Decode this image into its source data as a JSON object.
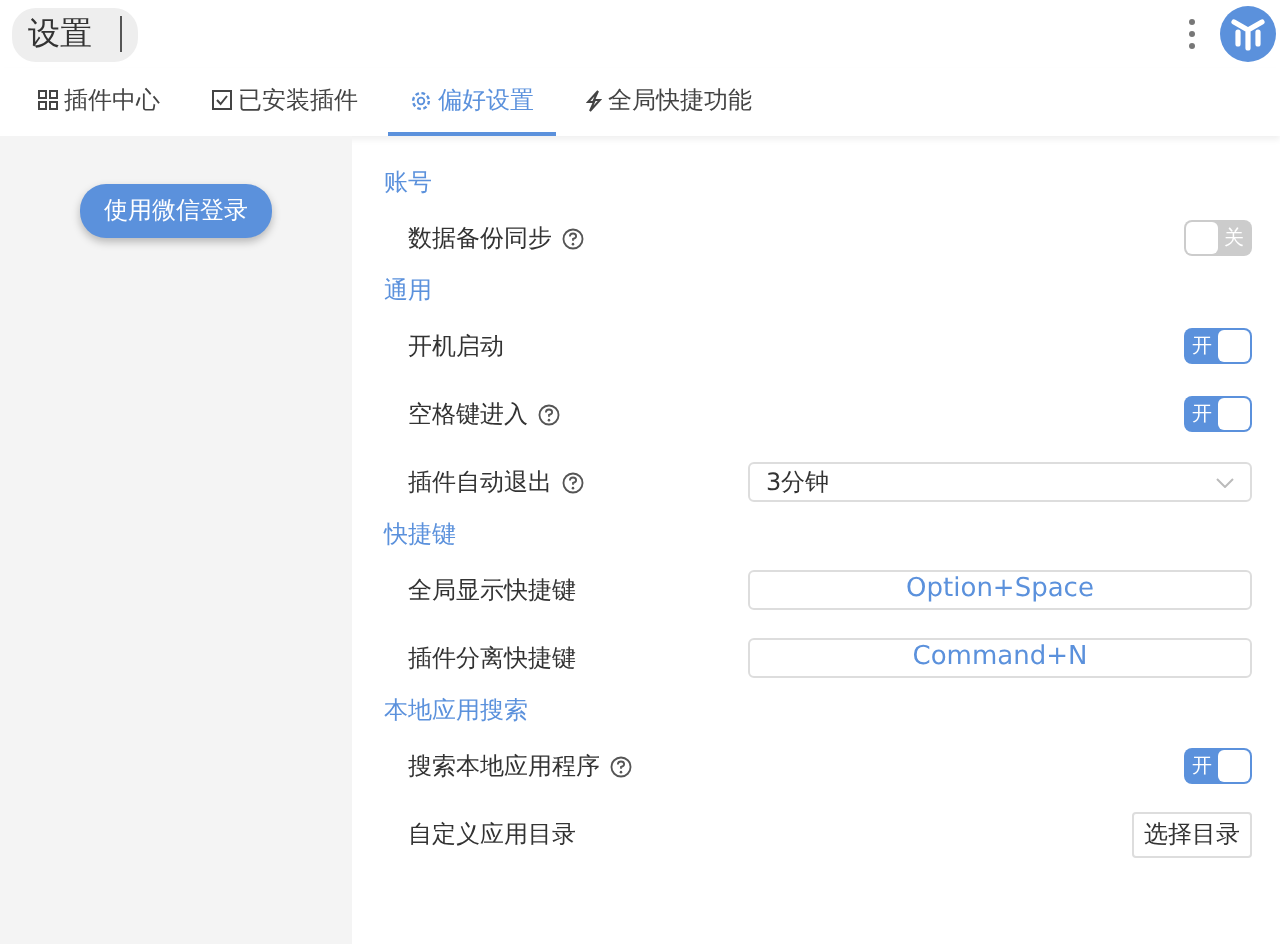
{
  "header": {
    "search_value": "设置"
  },
  "tabs": [
    {
      "label": "插件中心",
      "selected": false
    },
    {
      "label": "已安装插件",
      "selected": false
    },
    {
      "label": "偏好设置",
      "selected": true
    },
    {
      "label": "全局快捷功能",
      "selected": false
    }
  ],
  "sidebar": {
    "login_button": "使用微信登录"
  },
  "sections": [
    {
      "title": "账号",
      "rows": [
        {
          "kind": "toggle",
          "label": "数据备份同步",
          "help": true,
          "on": false,
          "toggle_text": "关"
        }
      ]
    },
    {
      "title": "通用",
      "rows": [
        {
          "kind": "toggle",
          "label": "开机启动",
          "help": false,
          "on": true,
          "toggle_text": "开"
        },
        {
          "kind": "toggle",
          "label": "空格键进入",
          "help": true,
          "on": true,
          "toggle_text": "开"
        },
        {
          "kind": "select",
          "label": "插件自动退出",
          "help": true,
          "value": "3分钟"
        }
      ]
    },
    {
      "title": "快捷键",
      "rows": [
        {
          "kind": "shortcut",
          "label": "全局显示快捷键",
          "help": false,
          "value": "Option+Space"
        },
        {
          "kind": "shortcut",
          "label": "插件分离快捷键",
          "help": false,
          "value": "Command+N"
        }
      ]
    },
    {
      "title": "本地应用搜索",
      "rows": [
        {
          "kind": "toggle",
          "label": "搜索本地应用程序",
          "help": true,
          "on": true,
          "toggle_text": "开"
        },
        {
          "kind": "button",
          "label": "自定义应用目录",
          "help": false,
          "value": "选择目录"
        }
      ]
    }
  ]
}
